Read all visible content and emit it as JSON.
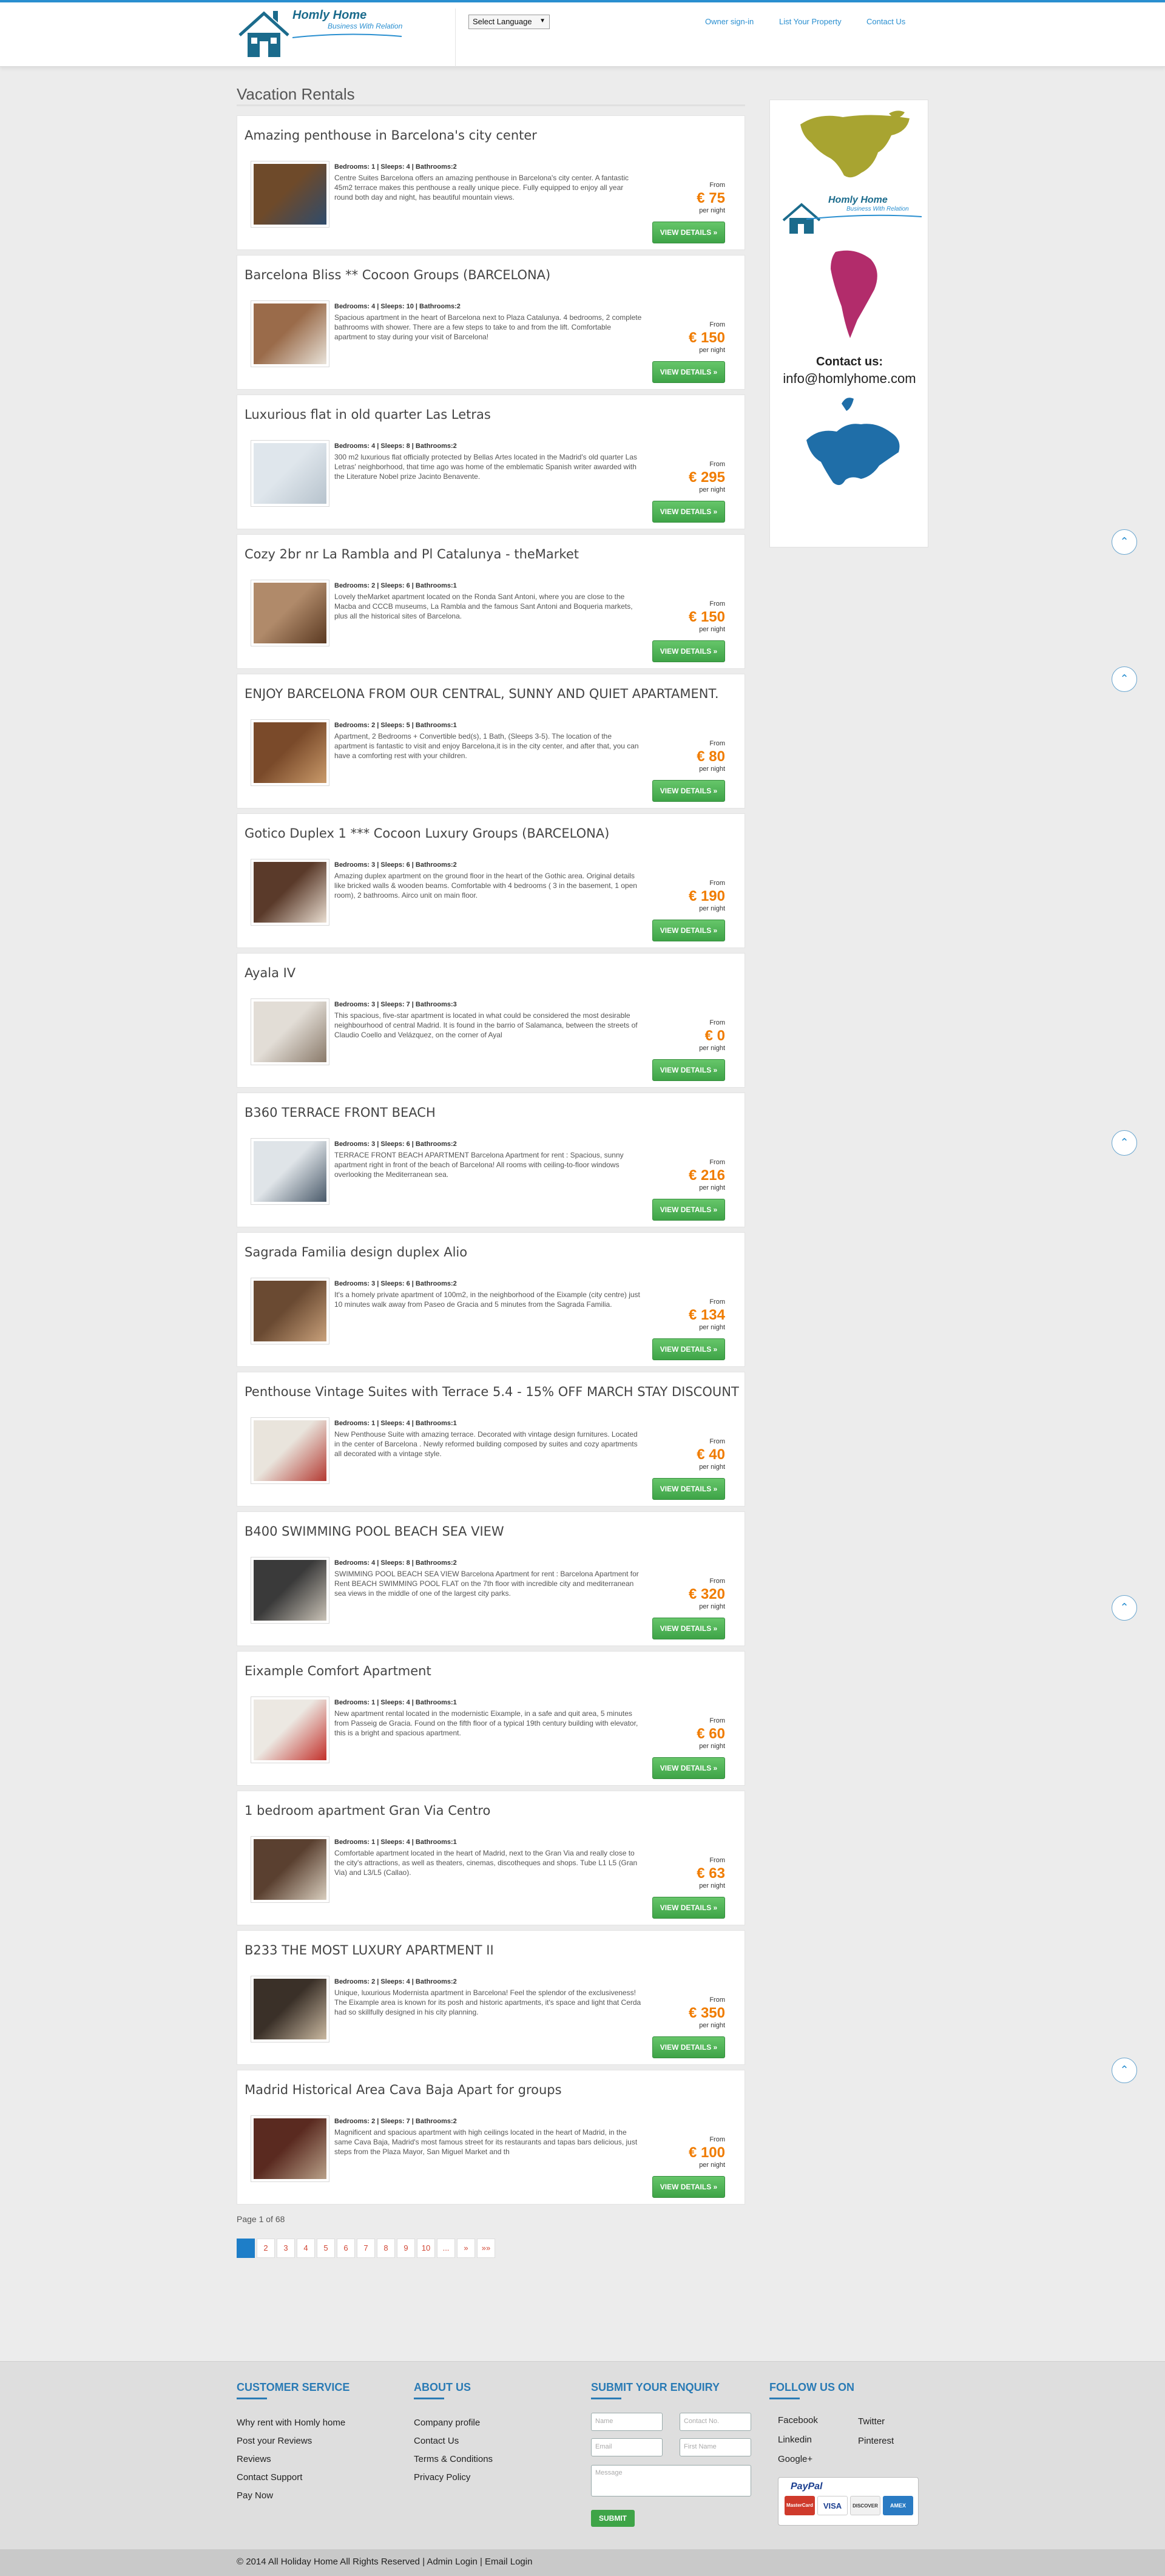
{
  "header": {
    "logo_name": "Homly Home",
    "logo_tagline": "Business With Relation",
    "language_select": "Select Language",
    "nav": [
      "Owner sign-in",
      "List Your Property",
      "Contact Us"
    ]
  },
  "main": {
    "title": "Vacation Rentals",
    "labels": {
      "from": "From",
      "per_night": "per night",
      "view_details": "VIEW DETAILS »"
    },
    "listings": [
      {
        "title": "Amazing penthouse in Barcelona's city center",
        "meta": "Bedrooms: 1 | Sleeps: 4 | Bathrooms:2",
        "description": "Centre Suites Barcelona offers an amazing penthouse in Barcelona's city center. A fantastic 45m2 terrace makes this penthouse a really unique piece. Fully equipped to enjoy all year round both day and night, has beautiful mountain views.",
        "price": "€ 75"
      },
      {
        "title": "Barcelona Bliss ** Cocoon Groups (BARCELONA)",
        "meta": "Bedrooms: 4 | Sleeps: 10 | Bathrooms:2",
        "description": "Spacious apartment in the heart of Barcelona next to Plaza Catalunya. 4 bedrooms, 2 complete bathrooms with shower. There are a few steps to take to and from the lift. Comfortable apartment to stay during your visit of Barcelona!",
        "price": "€ 150"
      },
      {
        "title": "Luxurious flat in old quarter Las Letras",
        "meta": "Bedrooms: 4 | Sleeps: 8 | Bathrooms:2",
        "description": "300 m2 luxurious flat officially protected by Bellas Artes located in the Madrid's old quarter Las Letras' neighborhood, that time ago was home of the emblematic Spanish writer awarded with the Literature Nobel prize Jacinto Benavente.",
        "price": "€ 295"
      },
      {
        "title": "Cozy 2br nr La Rambla and Pl Catalunya - theMarket",
        "meta": "Bedrooms: 2 | Sleeps: 6 | Bathrooms:1",
        "description": "Lovely theMarket apartment located on the Ronda Sant Antoni, where you are close to the Macba and CCCB museums, La Rambla and the famous Sant Antoni and Boqueria markets, plus all the historical sites of Barcelona.",
        "price": "€ 150"
      },
      {
        "title": "ENJOY BARCELONA FROM OUR CENTRAL, SUNNY AND QUIET APARTAMENT.",
        "meta": "Bedrooms: 2 | Sleeps: 5 | Bathrooms:1",
        "description": "Apartment, 2 Bedrooms + Convertible bed(s), 1 Bath, (Sleeps 3-5). The location of the apartment is fantastic to visit and enjoy Barcelona,it is in the city center, and after that, you can have a comforting rest with your children.",
        "price": "€ 80"
      },
      {
        "title": "Gotico Duplex 1 *** Cocoon Luxury Groups (BARCELONA)",
        "meta": "Bedrooms: 3 | Sleeps: 6 | Bathrooms:2",
        "description": "Amazing duplex apartment on the ground floor in the heart of the Gothic area. Original details like bricked walls & wooden beams. Comfortable with 4 bedrooms ( 3 in the basement, 1 open room), 2 bathrooms. Airco unit on main floor.",
        "price": "€ 190"
      },
      {
        "title": "Ayala IV",
        "meta": "Bedrooms: 3 | Sleeps: 7 | Bathrooms:3",
        "description": "This spacious, five-star apartment is located in what could be considered the most desirable neighbourhood of central Madrid. It is found in the barrio of Salamanca, between the streets of Claudio Coello and Velázquez, on the corner of Ayal",
        "price": "€ 0"
      },
      {
        "title": "B360 TERRACE FRONT BEACH",
        "meta": "Bedrooms: 3 | Sleeps: 6 | Bathrooms:2",
        "description": "TERRACE FRONT BEACH APARTMENT Barcelona Apartment for rent : Spacious, sunny apartment right in front of the beach of Barcelona! All rooms with ceiling-to-floor windows overlooking the Mediterranean sea.",
        "price": "€ 216"
      },
      {
        "title": "Sagrada Familia design duplex Alio",
        "meta": "Bedrooms: 3 | Sleeps: 6 | Bathrooms:2",
        "description": "It's a homely private apartment of 100m2, in the neighborhood of the Eixample (city centre) just 10 minutes walk away from Paseo de Gracia and 5 minutes from the Sagrada Familia.",
        "price": "€ 134"
      },
      {
        "title": "Penthouse Vintage Suites with Terrace 5.4 - 15% OFF MARCH STAY DISCOUNT",
        "meta": "Bedrooms: 1 | Sleeps: 4 | Bathrooms:1",
        "description": "New Penthouse Suite with amazing terrace. Decorated with vintage design furnitures. Located in the center of Barcelona . Newly reformed building composed by suites and cozy apartments all decorated with a vintage style.",
        "price": "€ 40"
      },
      {
        "title": "B400 SWIMMING POOL BEACH SEA VIEW",
        "meta": "Bedrooms: 4 | Sleeps: 8 | Bathrooms:2",
        "description": "SWIMMING POOL BEACH SEA VIEW Barcelona Apartment for rent : Barcelona Apartment for Rent BEACH SWIMMING POOL FLAT on the 7th floor with incredible city and mediterranean sea views in the middle of one of the largest city parks.",
        "price": "€ 320"
      },
      {
        "title": "Eixample Comfort Apartment",
        "meta": "Bedrooms: 1 | Sleeps: 4 | Bathrooms:1",
        "description": "New apartment rental located in the modernistic Eixample, in a safe and quit area, 5 minutes from Passeig de Gracia. Found on the fifth floor of a typical 19th century building with elevator, this is a bright and spacious apartment.",
        "price": "€ 60"
      },
      {
        "title": "1 bedroom apartment Gran Via Centro",
        "meta": "Bedrooms: 1 | Sleeps: 4 | Bathrooms:1",
        "description": "Comfortable apartment located in the heart of Madrid, next to the Gran Via and really close to the city's attractions, as well as theaters, cinemas, discotheques and shops. Tube L1 L5 (Gran Via) and L3/L5 (Callao).",
        "price": "€ 63"
      },
      {
        "title": "B233 THE MOST LUXURY APARTMENT II",
        "meta": "Bedrooms: 2 | Sleeps: 4 | Bathrooms:2",
        "description": "Unique, luxurious Modernista apartment in Barcelona! Feel the splendor of the exclusiveness! The Eixample area is known for its posh and historic apartments, it's space and light that Cerda had so skillfully designed in his city planning.",
        "price": "€ 350"
      },
      {
        "title": "Madrid Historical Area Cava Baja Apart for groups",
        "meta": "Bedrooms: 2 | Sleeps: 7 | Bathrooms:2",
        "description": "Magnificent and spacious apartment with high ceilings located in the heart of Madrid, in the same Cava Baja, Madrid's most famous street for its restaurants and tapas bars delicious, just steps from the Plaza Mayor, San Miguel Market and th",
        "price": "€ 100"
      }
    ],
    "page_info": "Page 1 of 68",
    "pagination": [
      "1",
      "2",
      "3",
      "4",
      "5",
      "6",
      "7",
      "8",
      "9",
      "10",
      "...",
      "»",
      "»»"
    ]
  },
  "sidebar": {
    "logo_name": "Homly Home",
    "logo_tagline": "Business With Relation",
    "contact_title": "Contact us:",
    "contact_email": "info@homlyhome.com"
  },
  "footer": {
    "customer_service": {
      "heading": "CUSTOMER SERVICE",
      "links": [
        "Why rent with Homly home",
        "Post your Reviews",
        "Reviews",
        "Contact Support",
        "Pay Now"
      ]
    },
    "about_us": {
      "heading": "ABOUT US",
      "links": [
        "Company profile",
        "Contact Us",
        "Terms & Conditions",
        "Privacy Policy"
      ]
    },
    "enquiry": {
      "heading": "SUBMIT YOUR ENQUIRY",
      "placeholders": [
        "Name",
        "Contact No.",
        "Email",
        "First Name",
        "Message"
      ],
      "submit": "SUBMIT"
    },
    "follow_us": {
      "heading": "FOLLOW US ON",
      "links": [
        "Facebook",
        "Twitter",
        "Linkedin",
        "Pinterest",
        "Google+"
      ]
    },
    "payment": {
      "paypal": "PayPal",
      "cards": [
        "MasterCard",
        "VISA",
        "DISCOVER",
        "AMEX"
      ]
    },
    "copyright": "© 2014 All Holiday Home All Rights Reserved | Admin Login | Email Login"
  },
  "colors": {
    "brand_blue": "#2a8fd0",
    "price_orange": "#f07c00",
    "button_green": "#3ea447",
    "footer_heading": "#2a7bb5"
  }
}
